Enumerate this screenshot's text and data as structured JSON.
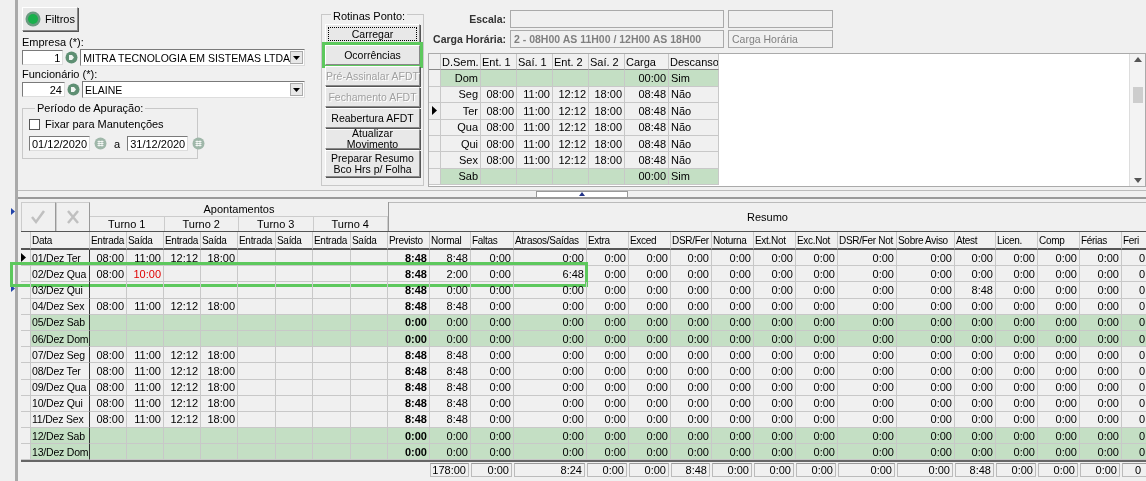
{
  "filters": {
    "button": "Filtros",
    "empresa_label": "Empresa (*):",
    "empresa_code": "1",
    "empresa_name": "MITRA TECNOLOGIA EM SISTEMAS LTDA",
    "funcionario_label": "Funcionário (*):",
    "funcionario_code": "24",
    "funcionario_name": "ELAINE",
    "period": {
      "title": "Período de Apuração:",
      "fix_label": "Fixar para Manutenções",
      "fix_checked": false,
      "from": "01/12/2020",
      "separator": "a",
      "to": "31/12/2020"
    }
  },
  "routines": {
    "title": "Rotinas Ponto:",
    "buttons": [
      {
        "label": "Carregar",
        "disabled": false,
        "highlighted": false,
        "focused": true
      },
      {
        "label": "Ocorrências",
        "disabled": false,
        "highlighted": true,
        "focused": false
      },
      {
        "label": "Pré-Assinalar AFDT",
        "disabled": true,
        "highlighted": false,
        "focused": false
      },
      {
        "label": "Fechamento AFDT",
        "disabled": true,
        "highlighted": false,
        "focused": false
      },
      {
        "label": "Reabertura AFDT",
        "disabled": false,
        "highlighted": false,
        "focused": false
      },
      {
        "label": "Atualizar Movimento",
        "disabled": false,
        "highlighted": false,
        "focused": false
      },
      {
        "label": "Preparar Resumo Bco Hrs p/ Folha",
        "disabled": false,
        "highlighted": false,
        "focused": false
      }
    ]
  },
  "schedule": {
    "escala_label": "Escala:",
    "carga_label": "Carga Horária:",
    "carga_value": "2 - 08H00 AS 11H00 / 12H00 AS 18H00",
    "carga_side": "Carga Horária",
    "columns": [
      "D.Sem.",
      "Ent. 1",
      "Saí. 1",
      "Ent. 2",
      "Saí. 2",
      "Carga",
      "Descanso"
    ],
    "rows": [
      {
        "day": "Dom",
        "load": "00:00",
        "rest_day": "Sim",
        "rest": true,
        "current": false
      },
      {
        "day": "Seg",
        "times": [
          "08:00",
          "11:00",
          "12:12",
          "18:00"
        ],
        "load": "08:48",
        "rest_day": "Não",
        "rest": false,
        "current": false
      },
      {
        "day": "Ter",
        "times": [
          "08:00",
          "11:00",
          "12:12",
          "18:00"
        ],
        "load": "08:48",
        "rest_day": "Não",
        "rest": false,
        "current": true
      },
      {
        "day": "Qua",
        "times": [
          "08:00",
          "11:00",
          "12:12",
          "18:00"
        ],
        "load": "08:48",
        "rest_day": "Não",
        "rest": false,
        "current": false
      },
      {
        "day": "Qui",
        "times": [
          "08:00",
          "11:00",
          "12:12",
          "18:00"
        ],
        "load": "08:48",
        "rest_day": "Não",
        "rest": false,
        "current": false
      },
      {
        "day": "Sex",
        "times": [
          "08:00",
          "11:00",
          "12:12",
          "18:00"
        ],
        "load": "08:48",
        "rest_day": "Não",
        "rest": false,
        "current": false
      },
      {
        "day": "Sab",
        "load": "00:00",
        "rest_day": "Sim",
        "rest": true,
        "current": false
      }
    ]
  },
  "grid": {
    "group_title": "Apontamentos",
    "shifts": [
      "Turno 1",
      "Turno 2",
      "Turno 3",
      "Turno 4"
    ],
    "summary_title": "Resumo",
    "columns": [
      "Data",
      "Entrada",
      "Saída",
      "Entrada",
      "Saída",
      "Entrada",
      "Saída",
      "Entrada",
      "Saída",
      "Previsto",
      "Normal",
      "Faltas",
      "Atrasos/Saídas",
      "Extra",
      "Exced",
      "DSR/Fer",
      "Noturna",
      "Ext.Not",
      "Exc.Not",
      "DSR/Fer Not",
      "Sobre Aviso",
      "Atest",
      "Licen.",
      "Comp",
      "Férias",
      "Feri"
    ],
    "rows": [
      {
        "date": "01/Dez Ter",
        "rest": false,
        "current": true,
        "highlighted": false,
        "punches": [
          {
            "value": "08:00",
            "flagged": false
          },
          {
            "value": "11:00",
            "flagged": false
          },
          {
            "value": "12:12",
            "flagged": false
          },
          {
            "value": "18:00",
            "flagged": false
          }
        ],
        "summary": [
          "8:48",
          "8:48",
          "0:00",
          "0:00",
          "0:00",
          "0:00",
          "0:00",
          "0:00",
          "0:00",
          "0:00",
          "0:00",
          "0:00",
          "0:00",
          "0:00",
          "0:00",
          "0:00",
          "0"
        ]
      },
      {
        "date": "02/Dez Qua",
        "rest": false,
        "current": false,
        "highlighted": true,
        "punches": [
          {
            "value": "08:00",
            "flagged": false
          },
          {
            "value": "10:00",
            "flagged": true
          }
        ],
        "summary": [
          "8:48",
          "2:00",
          "0:00",
          "6:48",
          "0:00",
          "0:00",
          "0:00",
          "0:00",
          "0:00",
          "0:00",
          "0:00",
          "0:00",
          "0:00",
          "0:00",
          "0:00",
          "0:00",
          "0"
        ]
      },
      {
        "date": "03/Dez Qui",
        "rest": false,
        "current": false,
        "highlighted": false,
        "summary": [
          "8:48",
          "0:00",
          "0:00",
          "0:00",
          "0:00",
          "0:00",
          "0:00",
          "0:00",
          "0:00",
          "0:00",
          "0:00",
          "0:00",
          "8:48",
          "0:00",
          "0:00",
          "0:00",
          "0"
        ]
      },
      {
        "date": "04/Dez Sex",
        "rest": false,
        "current": false,
        "highlighted": false,
        "punches": [
          {
            "value": "08:00",
            "flagged": false
          },
          {
            "value": "11:00",
            "flagged": false
          },
          {
            "value": "12:12",
            "flagged": false
          },
          {
            "value": "18:00",
            "flagged": false
          }
        ],
        "summary": [
          "8:48",
          "8:48",
          "0:00",
          "0:00",
          "0:00",
          "0:00",
          "0:00",
          "0:00",
          "0:00",
          "0:00",
          "0:00",
          "0:00",
          "0:00",
          "0:00",
          "0:00",
          "0:00",
          "0"
        ]
      },
      {
        "date": "05/Dez Sab",
        "rest": true,
        "current": false,
        "highlighted": false,
        "summary": [
          "0:00",
          "0:00",
          "0:00",
          "0:00",
          "0:00",
          "0:00",
          "0:00",
          "0:00",
          "0:00",
          "0:00",
          "0:00",
          "0:00",
          "0:00",
          "0:00",
          "0:00",
          "0:00",
          "0"
        ]
      },
      {
        "date": "06/Dez Dom",
        "rest": true,
        "current": false,
        "highlighted": false,
        "summary": [
          "0:00",
          "0:00",
          "0:00",
          "0:00",
          "0:00",
          "0:00",
          "0:00",
          "0:00",
          "0:00",
          "0:00",
          "0:00",
          "0:00",
          "0:00",
          "0:00",
          "0:00",
          "0:00",
          "0"
        ]
      },
      {
        "date": "07/Dez Seg",
        "rest": false,
        "current": false,
        "highlighted": false,
        "punches": [
          {
            "value": "08:00",
            "flagged": false
          },
          {
            "value": "11:00",
            "flagged": false
          },
          {
            "value": "12:12",
            "flagged": false
          },
          {
            "value": "18:00",
            "flagged": false
          }
        ],
        "summary": [
          "8:48",
          "8:48",
          "0:00",
          "0:00",
          "0:00",
          "0:00",
          "0:00",
          "0:00",
          "0:00",
          "0:00",
          "0:00",
          "0:00",
          "0:00",
          "0:00",
          "0:00",
          "0:00",
          "0"
        ]
      },
      {
        "date": "08/Dez Ter",
        "rest": false,
        "current": false,
        "highlighted": false,
        "punches": [
          {
            "value": "08:00",
            "flagged": false
          },
          {
            "value": "11:00",
            "flagged": false
          },
          {
            "value": "12:12",
            "flagged": false
          },
          {
            "value": "18:00",
            "flagged": false
          }
        ],
        "summary": [
          "8:48",
          "8:48",
          "0:00",
          "0:00",
          "0:00",
          "0:00",
          "0:00",
          "0:00",
          "0:00",
          "0:00",
          "0:00",
          "0:00",
          "0:00",
          "0:00",
          "0:00",
          "0:00",
          "0"
        ]
      },
      {
        "date": "09/Dez Qua",
        "rest": false,
        "current": false,
        "highlighted": false,
        "punches": [
          {
            "value": "08:00",
            "flagged": false
          },
          {
            "value": "11:00",
            "flagged": false
          },
          {
            "value": "12:12",
            "flagged": false
          },
          {
            "value": "18:00",
            "flagged": false
          }
        ],
        "summary": [
          "8:48",
          "8:48",
          "0:00",
          "0:00",
          "0:00",
          "0:00",
          "0:00",
          "0:00",
          "0:00",
          "0:00",
          "0:00",
          "0:00",
          "0:00",
          "0:00",
          "0:00",
          "0:00",
          "0"
        ]
      },
      {
        "date": "10/Dez Qui",
        "rest": false,
        "current": false,
        "highlighted": false,
        "punches": [
          {
            "value": "08:00",
            "flagged": false
          },
          {
            "value": "11:00",
            "flagged": false
          },
          {
            "value": "12:12",
            "flagged": false
          },
          {
            "value": "18:00",
            "flagged": false
          }
        ],
        "summary": [
          "8:48",
          "8:48",
          "0:00",
          "0:00",
          "0:00",
          "0:00",
          "0:00",
          "0:00",
          "0:00",
          "0:00",
          "0:00",
          "0:00",
          "0:00",
          "0:00",
          "0:00",
          "0:00",
          "0"
        ]
      },
      {
        "date": "11/Dez Sex",
        "rest": false,
        "current": false,
        "highlighted": false,
        "punches": [
          {
            "value": "08:00",
            "flagged": false
          },
          {
            "value": "11:00",
            "flagged": false
          },
          {
            "value": "12:12",
            "flagged": false
          },
          {
            "value": "18:00",
            "flagged": false
          }
        ],
        "summary": [
          "8:48",
          "8:48",
          "0:00",
          "0:00",
          "0:00",
          "0:00",
          "0:00",
          "0:00",
          "0:00",
          "0:00",
          "0:00",
          "0:00",
          "0:00",
          "0:00",
          "0:00",
          "0:00",
          "0"
        ]
      },
      {
        "date": "12/Dez Sab",
        "rest": true,
        "current": false,
        "highlighted": false,
        "summary": [
          "0:00",
          "0:00",
          "0:00",
          "0:00",
          "0:00",
          "0:00",
          "0:00",
          "0:00",
          "0:00",
          "0:00",
          "0:00",
          "0:00",
          "0:00",
          "0:00",
          "0:00",
          "0:00",
          "0"
        ]
      },
      {
        "date": "13/Dez Dom",
        "rest": true,
        "current": false,
        "highlighted": false,
        "summary": [
          "0:00",
          "0:00",
          "0:00",
          "0:00",
          "0:00",
          "0:00",
          "0:00",
          "0:00",
          "0:00",
          "0:00",
          "0:00",
          "0:00",
          "0:00",
          "0:00",
          "0:00",
          "0:00",
          "0"
        ]
      }
    ],
    "totals": [
      "178:00",
      "0:00",
      "8:24",
      "0:00",
      "0:00",
      "8:48",
      "0:00",
      "0:00",
      "0:00",
      "0:00",
      "0:00",
      "8:48",
      "0:00",
      "0:00",
      "0:00",
      "0"
    ]
  }
}
